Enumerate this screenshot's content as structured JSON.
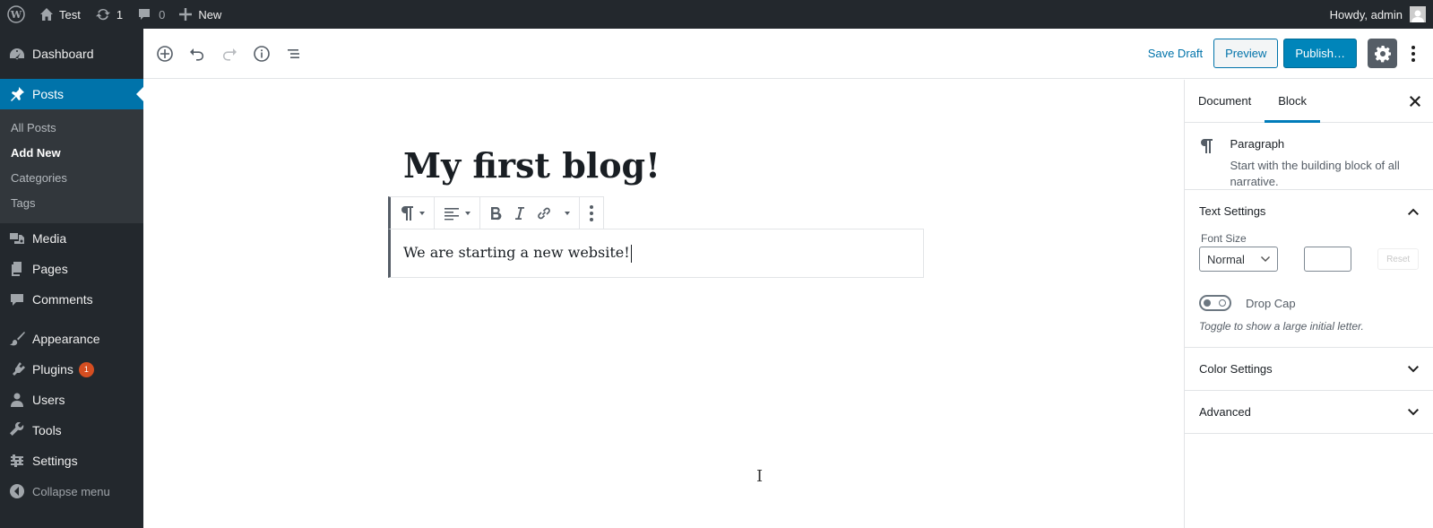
{
  "admin_bar": {
    "site_name": "Test",
    "updates_count": "1",
    "comments_count": "0",
    "new_label": "New",
    "greeting": "Howdy, admin"
  },
  "menu": {
    "dashboard": "Dashboard",
    "posts": "Posts",
    "posts_sub": [
      "All Posts",
      "Add New",
      "Categories",
      "Tags"
    ],
    "media": "Media",
    "pages": "Pages",
    "comments": "Comments",
    "appearance": "Appearance",
    "plugins": "Plugins",
    "plugins_badge": "1",
    "users": "Users",
    "tools": "Tools",
    "settings": "Settings",
    "collapse": "Collapse menu"
  },
  "header": {
    "save_draft": "Save Draft",
    "preview": "Preview",
    "publish": "Publish…"
  },
  "editor": {
    "title": "My first blog!",
    "paragraph": "We are starting a new website!"
  },
  "sidebar": {
    "tab_document": "Document",
    "tab_block": "Block",
    "block_name": "Paragraph",
    "block_description": "Start with the building block of all narrative.",
    "text_settings": "Text Settings",
    "font_size_label": "Font Size",
    "font_size_value": "Normal",
    "reset": "Reset",
    "drop_cap": "Drop Cap",
    "drop_cap_help": "Toggle to show a large initial letter.",
    "color_settings": "Color Settings",
    "advanced": "Advanced"
  },
  "colors": {
    "admin_bg": "#23282d",
    "accent": "#0073aa",
    "publish": "#0085ba"
  }
}
